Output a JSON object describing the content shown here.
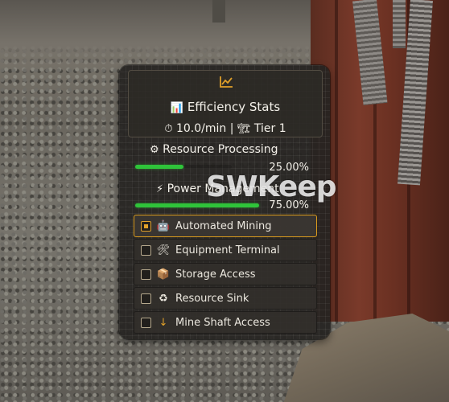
{
  "watermark": "SWKeep",
  "header": {
    "chart_icon": "trend-chart-icon",
    "title_icon": "bar-chart-icon",
    "title": "Efficiency Stats",
    "timer_icon": "stopwatch-icon",
    "rate": "10.0/min",
    "separator": "|",
    "tier_icon": "crane-icon",
    "tier": "Tier 1"
  },
  "sections": [
    {
      "icon": "gear-icon",
      "label": "Resource Processing",
      "progress": 0.25,
      "percent_text": "25.00%",
      "bar_color": "#2fc43a"
    },
    {
      "icon": "lightning-icon",
      "label": "Power Management",
      "progress": 0.75,
      "percent_text": "75.00%",
      "bar_color": "#2fc43a"
    }
  ],
  "menu": {
    "accent_color": "#d99a1d",
    "items": [
      {
        "label": "Automated Mining",
        "icon": "robot-icon",
        "checked": true
      },
      {
        "label": "Equipment Terminal",
        "icon": "tools-icon",
        "checked": false
      },
      {
        "label": "Storage Access",
        "icon": "storage-icon",
        "checked": false
      },
      {
        "label": "Resource Sink",
        "icon": "recycle-icon",
        "checked": false
      },
      {
        "label": "Mine Shaft Access",
        "icon": "down-arrow-icon",
        "checked": false
      }
    ]
  }
}
